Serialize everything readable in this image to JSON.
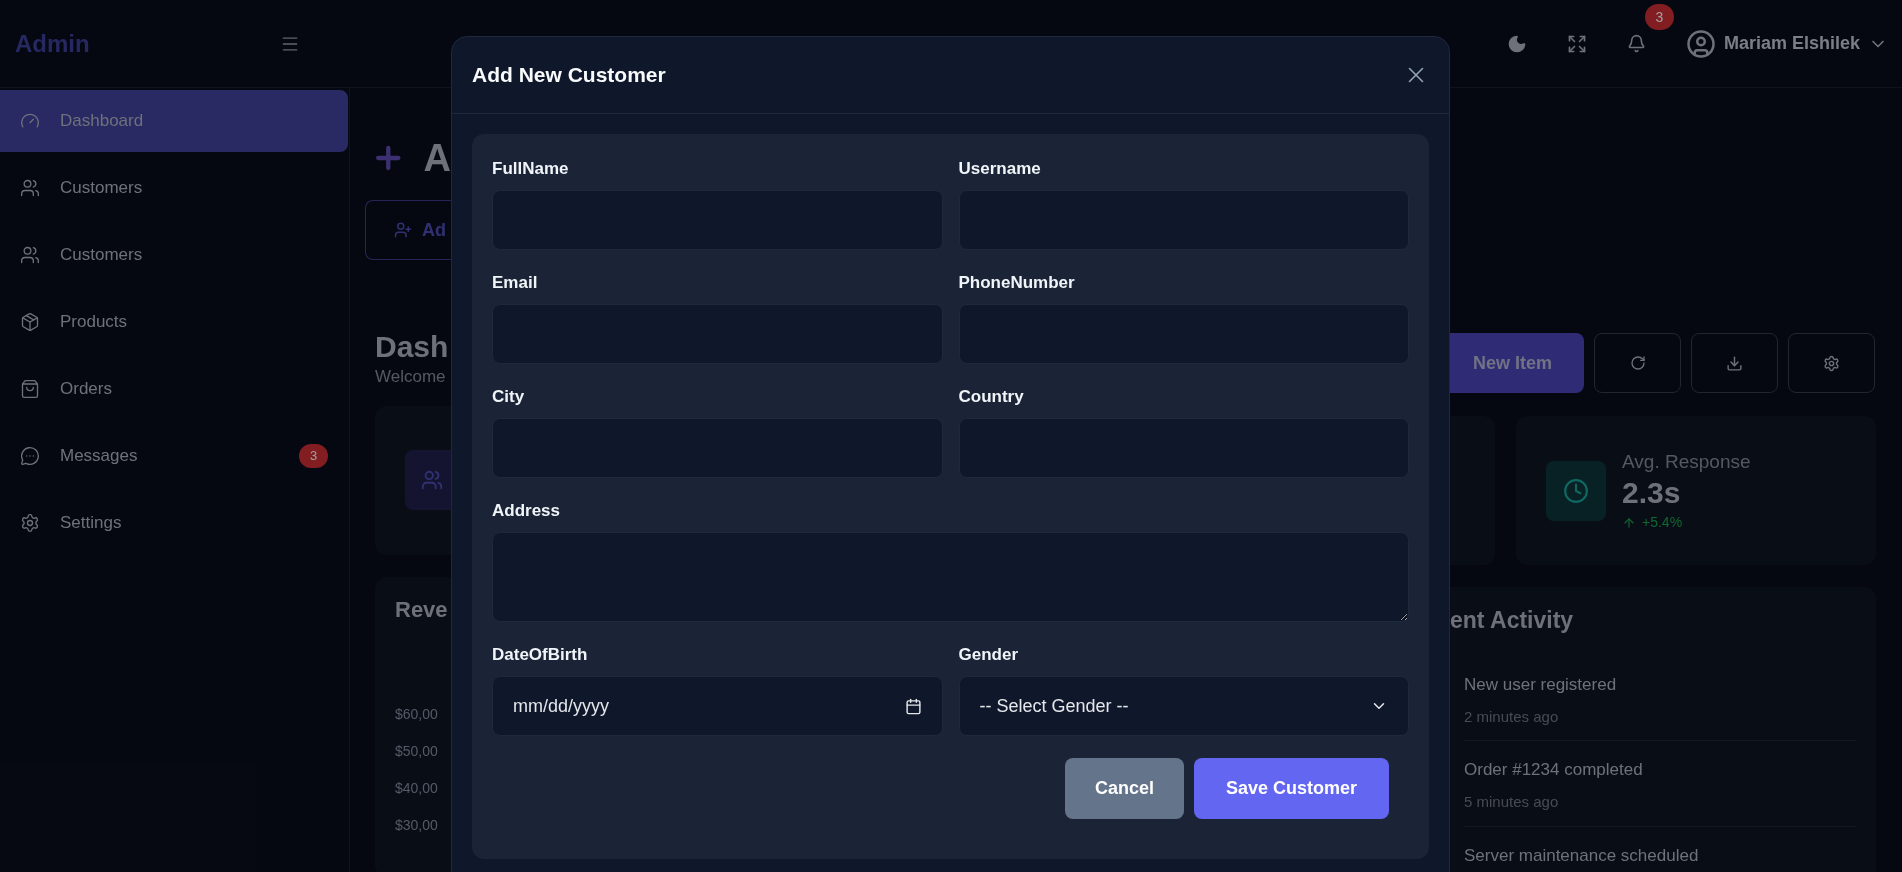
{
  "header": {
    "brand": "Admin",
    "notification_count": "3",
    "user_name": "Mariam Elshilek"
  },
  "sidebar": {
    "items": [
      {
        "label": "Dashboard",
        "selected": true
      },
      {
        "label": "Customers",
        "selected": false
      },
      {
        "label": "Customers",
        "selected": false
      },
      {
        "label": "Products",
        "selected": false
      },
      {
        "label": "Orders",
        "selected": false
      },
      {
        "label": "Messages",
        "selected": false,
        "badge": "3"
      },
      {
        "label": "Settings",
        "selected": false
      }
    ]
  },
  "page": {
    "title": "A",
    "add_button": "Ad",
    "heading": "Dash",
    "subtitle": "Welcome",
    "new_item_button": "New Item",
    "stat": {
      "label": "Avg. Response",
      "value": "2.3s",
      "change": "+5.4%"
    },
    "revenue": {
      "title": "Reve",
      "axis_labels": [
        "$60,00",
        "$50,00",
        "$40,00",
        "$30,00"
      ]
    },
    "activity": {
      "title": "ent Activity",
      "items": [
        {
          "title": "New user registered",
          "time": "2 minutes ago"
        },
        {
          "title": "Order #1234 completed",
          "time": "5 minutes ago"
        },
        {
          "title": "Server maintenance scheduled"
        }
      ]
    }
  },
  "modal": {
    "title": "Add New Customer",
    "fields": [
      {
        "label": "FullName",
        "kind": "text"
      },
      {
        "label": "Username",
        "kind": "text"
      },
      {
        "label": "Email",
        "kind": "text"
      },
      {
        "label": "PhoneNumber",
        "kind": "text"
      },
      {
        "label": "City",
        "kind": "text"
      },
      {
        "label": "Country",
        "kind": "text"
      },
      {
        "label": "Address",
        "kind": "textarea"
      },
      {
        "label": "DateOfBirth",
        "kind": "date",
        "placeholder": "mm/dd/yyyy"
      },
      {
        "label": "Gender",
        "kind": "select",
        "value": "-- Select Gender --"
      }
    ],
    "buttons": [
      {
        "label": "Cancel",
        "kind": "secondary"
      },
      {
        "label": "Save Customer",
        "kind": "primary"
      }
    ]
  }
}
